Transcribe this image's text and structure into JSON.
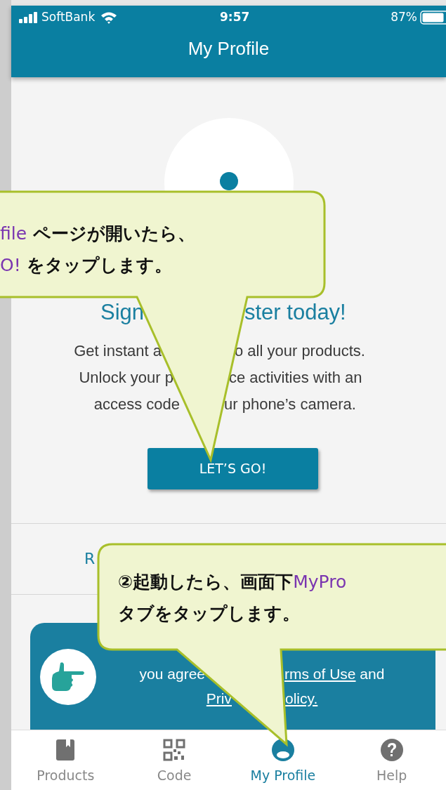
{
  "status_bar": {
    "carrier": "SoftBank",
    "time": "9:57",
    "battery": "87%"
  },
  "header": {
    "title": "My Profile"
  },
  "hero": {
    "heading": [
      "Sign",
      "ster today!"
    ],
    "description": [
      [
        "Get instant a",
        "o all your products."
      ],
      [
        "Unlock your p",
        "ce activities with an"
      ],
      [
        "access code",
        "ur phone’s camera."
      ]
    ],
    "button": "LET’S GO!"
  },
  "link": {
    "label": "R"
  },
  "banner": {
    "lines": [
      [
        [
          {
            "text": "you agree",
            "link": false
          }
        ],
        [
          {
            "text": "rms of Use",
            "link": true
          },
          {
            "text": " and",
            "link": false
          }
        ]
      ],
      [
        [
          {
            "text": "Priv",
            "link": true
          }
        ],
        [
          {
            "text": "olicy.",
            "link": true
          }
        ]
      ]
    ]
  },
  "tabs": [
    {
      "label": "Products",
      "kind": "book",
      "selected": false
    },
    {
      "label": "Code",
      "kind": "qr",
      "selected": false
    },
    {
      "label": "My Profile",
      "kind": "person",
      "selected": true
    },
    {
      "label": "Help",
      "kind": "help",
      "selected": false
    }
  ],
  "callouts": [
    {
      "lines": [
        [
          {
            "text": "file",
            "highlight": true
          },
          {
            "text": " ページが開いたら、",
            "highlight": false
          }
        ],
        [
          {
            "text": "O!",
            "highlight": true
          },
          {
            "text": " をタップします。",
            "highlight": false
          }
        ]
      ]
    },
    {
      "lines": [
        [
          {
            "text": "②起動したら、画面下",
            "highlight": false
          },
          {
            "text": "MyPro",
            "highlight": true
          }
        ],
        [
          {
            "text": "タブをタップします。",
            "highlight": false
          }
        ]
      ]
    }
  ]
}
